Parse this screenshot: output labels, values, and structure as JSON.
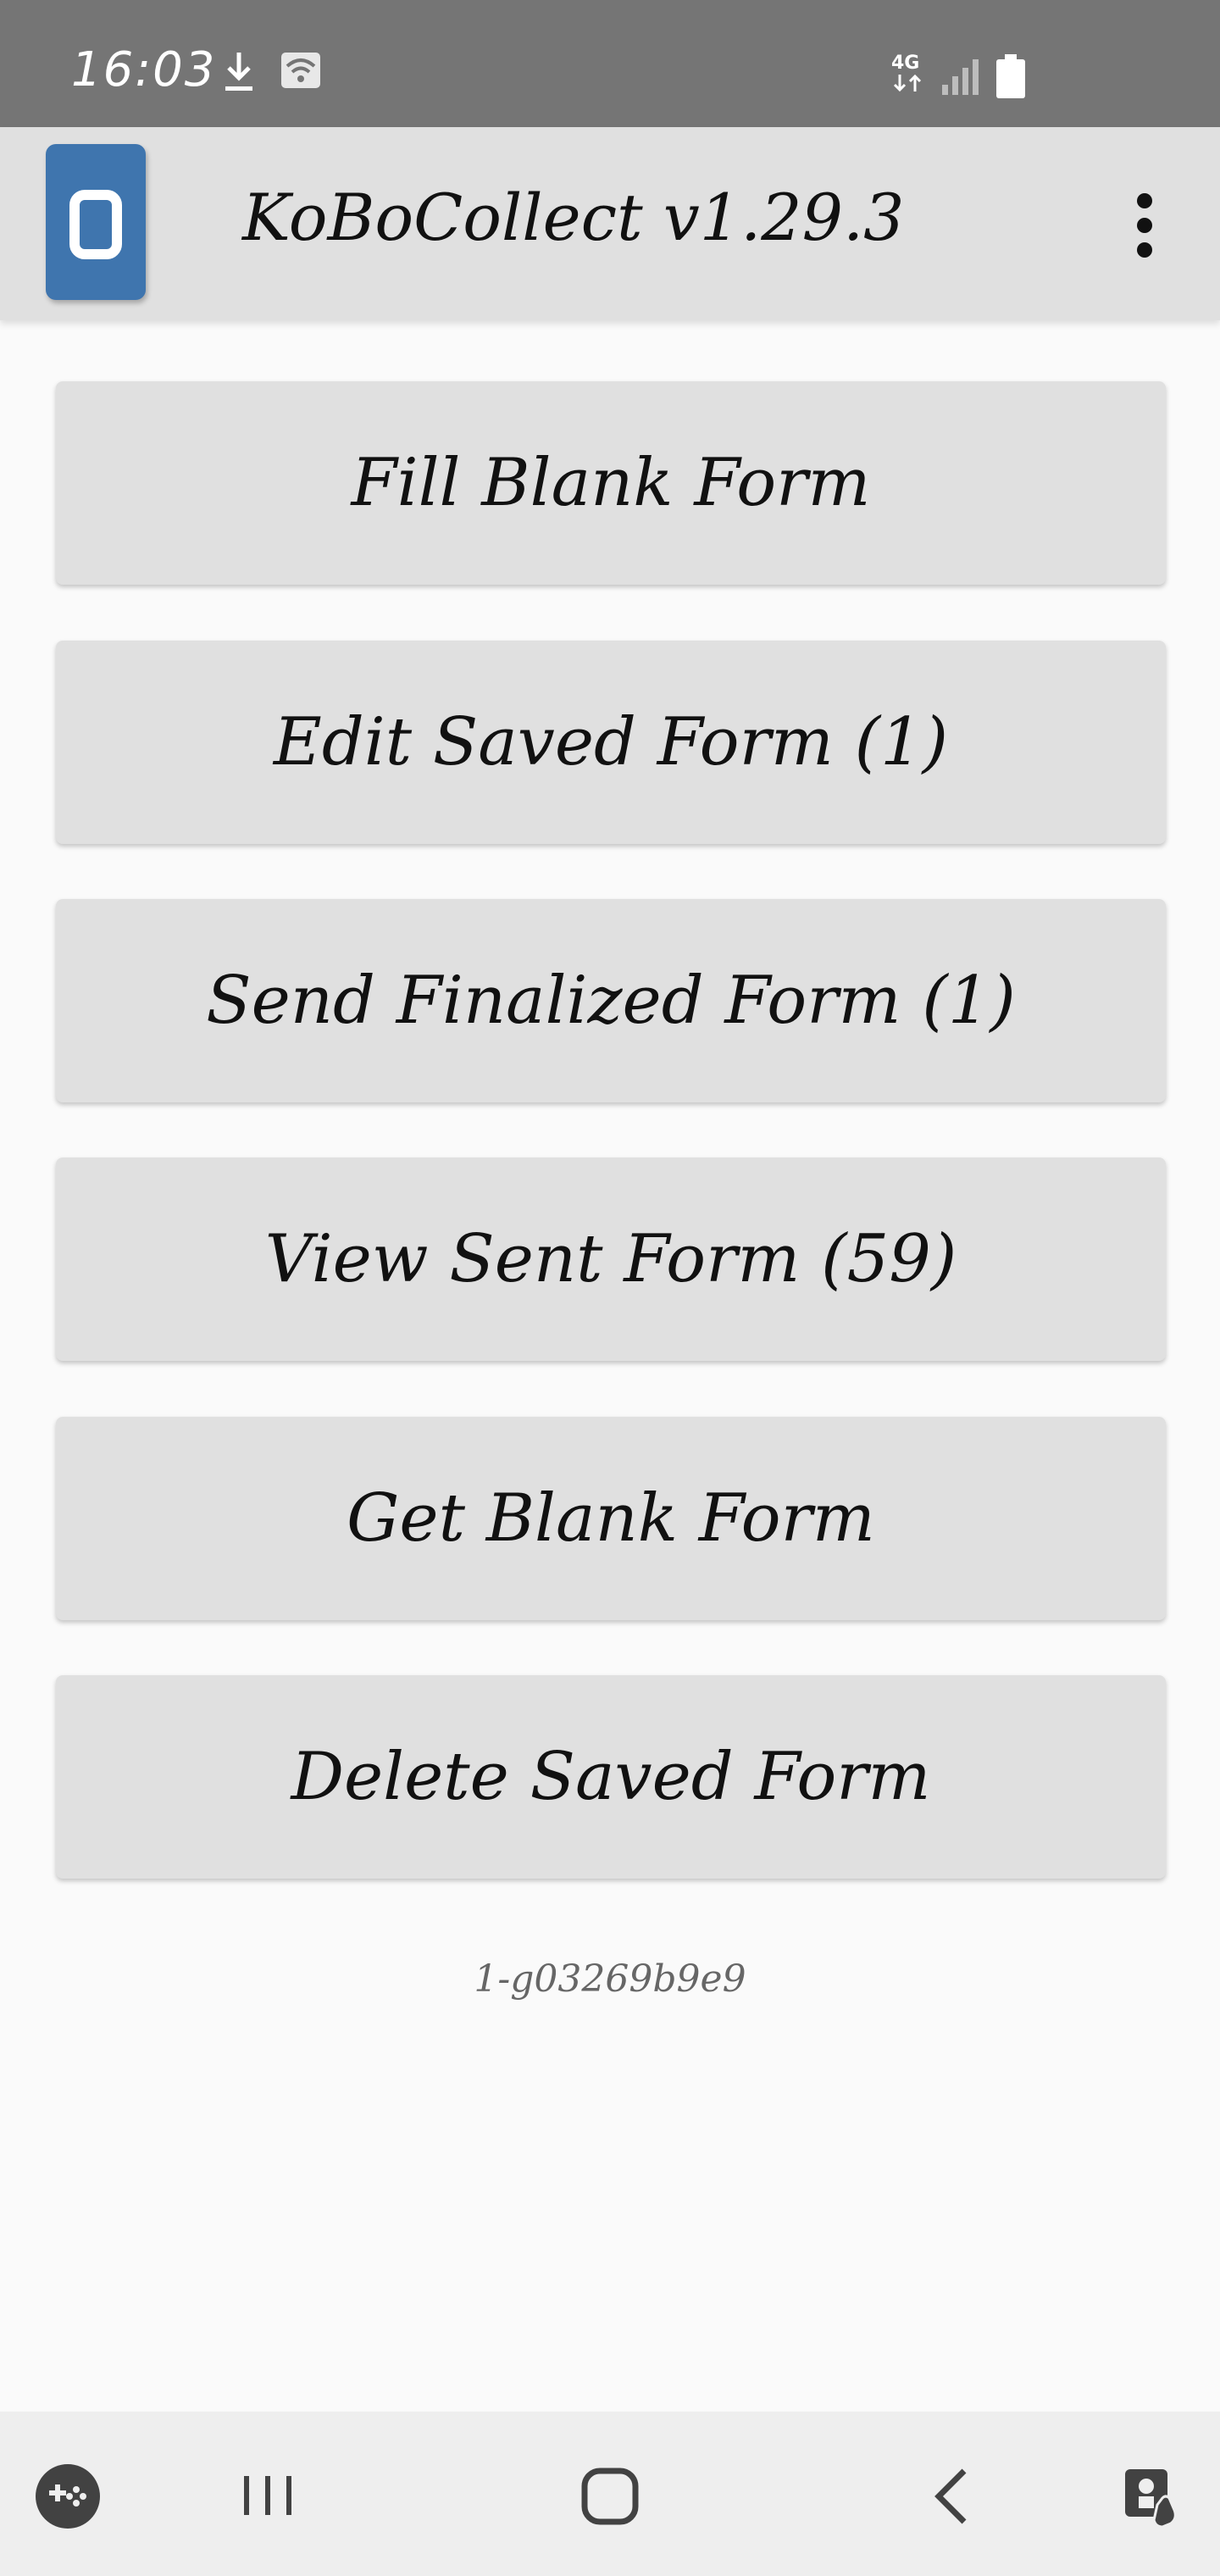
{
  "status_bar": {
    "time": "16:03",
    "network_label": "4G",
    "icons": [
      "download-icon",
      "wifi-icon",
      "mobile-data-icon",
      "signal-icon",
      "battery-icon"
    ]
  },
  "app_bar": {
    "title": "KoBoCollect v1.29.3",
    "logo_icon": "kobo-logo-icon",
    "menu_icon": "more-vert-icon"
  },
  "main_menu": {
    "buttons": [
      {
        "label": "Fill Blank Form"
      },
      {
        "label": "Edit Saved Form (1)"
      },
      {
        "label": "Send Finalized Form (1)"
      },
      {
        "label": "View Sent Form (59)"
      },
      {
        "label": "Get Blank Form"
      },
      {
        "label": "Delete Saved Form"
      }
    ]
  },
  "version_code": "1-g03269b9e9",
  "nav_bar": {
    "icons": [
      "game-launcher-icon",
      "recent-apps-icon",
      "home-icon",
      "back-icon",
      "accessibility-icon"
    ]
  },
  "colors": {
    "status_bar": "#757575",
    "app_bar": "#e0e0e0",
    "button": "#e0e0e0",
    "background": "#fafafa",
    "logo": "#3f75ae"
  }
}
